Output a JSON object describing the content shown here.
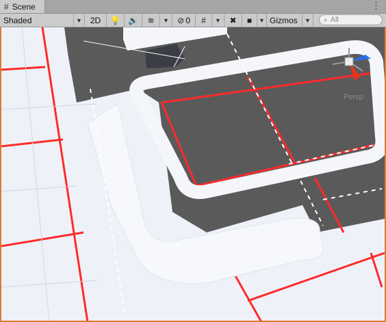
{
  "tab": {
    "label": "Scene",
    "icon": "grid-icon"
  },
  "toolbar": {
    "shading_mode": "Shaded",
    "mode_2d": "2D",
    "hidden_count": "0",
    "gizmos_label": "Gizmos",
    "search_placeholder": "All"
  },
  "viewport": {
    "perspective_label": "Persp"
  },
  "colors": {
    "accent_border": "#e07a2e",
    "grid_red": "#ff1a1a",
    "road_gray": "#5a5a5a",
    "floor_white": "#eef2f8"
  }
}
